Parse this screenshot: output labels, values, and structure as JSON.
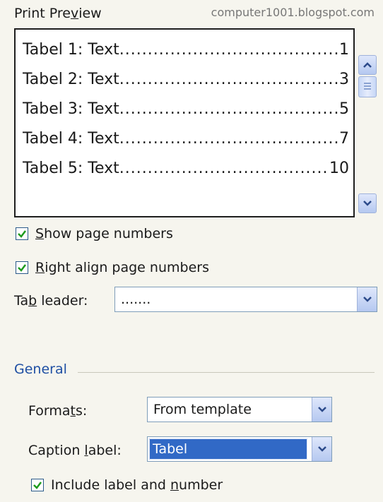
{
  "header": {
    "title_pre": "Print Pre",
    "title_underlined": "v",
    "title_post": "iew",
    "watermark": "computer1001.blogspot.com"
  },
  "preview": {
    "entries": [
      {
        "label": "Tabel 1: Text",
        "page": "1"
      },
      {
        "label": "Tabel 2: Text",
        "page": "3"
      },
      {
        "label": "Tabel 3: Text",
        "page": "5"
      },
      {
        "label": "Tabel 4: Text",
        "page": "7"
      },
      {
        "label": "Tabel 5: Text",
        "page": "10"
      }
    ],
    "leader": "..................................................."
  },
  "options": {
    "show_page_numbers": {
      "pre": "",
      "ul": "S",
      "post": "how page numbers",
      "checked": true
    },
    "right_align": {
      "pre": "",
      "ul": "R",
      "post": "ight align page numbers",
      "checked": true
    },
    "tab_leader": {
      "label_pre": "Ta",
      "label_ul": "b",
      "label_post": " leader:",
      "value": "......."
    }
  },
  "general": {
    "section_label": "General",
    "formats": {
      "label_pre": "Forma",
      "label_ul": "t",
      "label_post": "s:",
      "value": "From template"
    },
    "caption_label": {
      "label_pre": "Caption ",
      "label_ul": "l",
      "label_post": "abel:",
      "value": "Tabel"
    },
    "include_label": {
      "pre": "Include label and ",
      "ul": "n",
      "post": "umber",
      "checked": true
    }
  },
  "colors": {
    "background": "#f6f5ee",
    "section_heading": "#1f4fa3",
    "selection": "#3169c6",
    "check": "#1e9b1e"
  },
  "icons": [
    "scroll-up-icon",
    "scroll-down-icon",
    "chevron-down-icon",
    "checkmark-icon"
  ]
}
